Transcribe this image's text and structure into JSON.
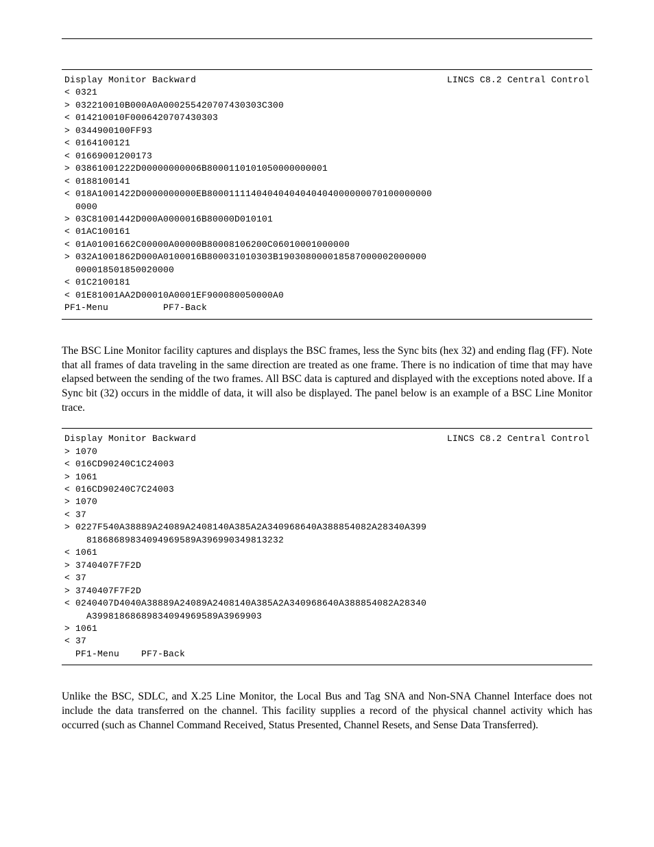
{
  "panel1": {
    "titleLeft": "Display Monitor Backward",
    "titleRight": "LINCS C8.2 Central Control",
    "lines": [
      "< 0321",
      "> 032210010B000A0A000255420707430303C300",
      "< 014210010F0006420707430303",
      "> 0344900100FF93",
      "< 0164100121",
      "< 01669001200173",
      "> 03861001222D00000000006B8000110101050000000001",
      "< 0188100141",
      "< 018A1001422D0000000000EB80001111404040404040404000000070100000000",
      "  0000",
      "> 03C81001442D000A0000016B80000D010101",
      "< 01AC100161",
      "< 01A01001662C00000A00000B80008106200C06010001000000",
      "> 032A1001862D000A0100016B800031010303B190308000018587000002000000",
      "  000018501850020000",
      "< 01C2100181",
      "< 01E81001AA2D00010A0001EF900080050000A0"
    ],
    "pf1": "PF1-Menu",
    "pf7": "PF7-Back"
  },
  "para1": "The BSC Line Monitor facility captures and displays the BSC frames, less the Sync bits (hex 32) and ending flag (FF). Note that all frames of data traveling in the same direction are treated as one frame. There is no indication of time that may have elapsed between the sending of the two frames. All BSC data is captured and displayed with the exceptions noted above. If a Sync bit (32) occurs in the middle of data, it will also be displayed. The panel below is an example of a BSC Line Monitor trace.",
  "panel2": {
    "titleLeft": "Display Monitor Backward",
    "titleRight": "LINCS C8.2 Central Control",
    "lines": [
      "> 1070",
      "< 016CD90240C1C24003",
      "> 1061",
      "< 016CD90240C7C24003",
      "> 1070",
      "< 37",
      "> 0227F540A38889A24089A2408140A385A2A340968640A388854082A28340A399",
      "    81868689834094969589A396990349813232",
      "< 1061",
      "> 3740407F7F2D",
      "< 37",
      "> 3740407F7F2D",
      "< 0240407D4040A38889A24089A2408140A385A2A340968640A388854082A28340",
      "    A39981868689834094969589A3969903",
      "> 1061",
      "< 37"
    ],
    "pf1": "PF1-Menu",
    "pf7": "PF7-Back"
  },
  "para2": "Unlike the BSC, SDLC, and X.25 Line Monitor, the Local Bus and Tag SNA and Non-SNA Channel Interface does not include the data transferred on the channel. This facility supplies a record of the physical channel activity which has occurred (such as Channel Command Received, Status Presented, Channel Resets, and Sense Data Transferred)."
}
